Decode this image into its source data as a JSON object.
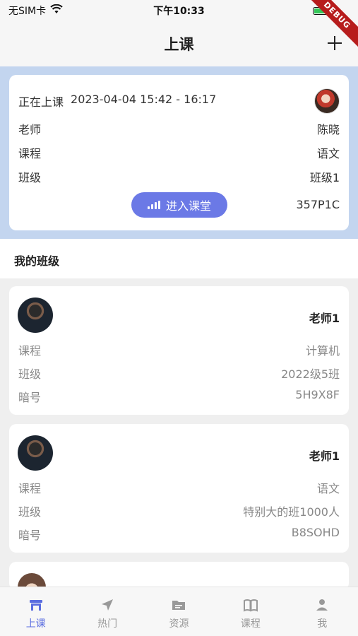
{
  "status_bar": {
    "carrier": "无SIM卡",
    "time": "下午10:33"
  },
  "debug_label": "DEBUG",
  "nav": {
    "title": "上课"
  },
  "current_class": {
    "status": "正在上课",
    "time_range": "2023-04-04 15:42 - 16:17",
    "teacher_label": "老师",
    "teacher_value": "陈晓",
    "course_label": "课程",
    "course_value": "语文",
    "class_label": "班级",
    "class_value": "班级1",
    "enter_label": "进入课堂",
    "code": "357P1C"
  },
  "my_classes": {
    "title": "我的班级",
    "items": [
      {
        "teacher": "老师1",
        "course_label": "课程",
        "course": "计算机",
        "class_label": "班级",
        "class": "2022级5班",
        "code_label": "暗号",
        "code": "5H9X8F"
      },
      {
        "teacher": "老师1",
        "course_label": "课程",
        "course": "语文",
        "class_label": "班级",
        "class": "特别大的班1000人",
        "code_label": "暗号",
        "code": "B8SOHD"
      }
    ]
  },
  "tabs": [
    {
      "label": "上课",
      "icon": "classroom-icon",
      "active": true
    },
    {
      "label": "热门",
      "icon": "navigation-arrow-icon",
      "active": false
    },
    {
      "label": "资源",
      "icon": "folder-icon",
      "active": false
    },
    {
      "label": "课程",
      "icon": "book-icon",
      "active": false
    },
    {
      "label": "我",
      "icon": "person-icon",
      "active": false
    }
  ],
  "colors": {
    "accent": "#6b79e6",
    "active_tab": "#5a6de0",
    "banner_bg": "#c3d5ef"
  }
}
